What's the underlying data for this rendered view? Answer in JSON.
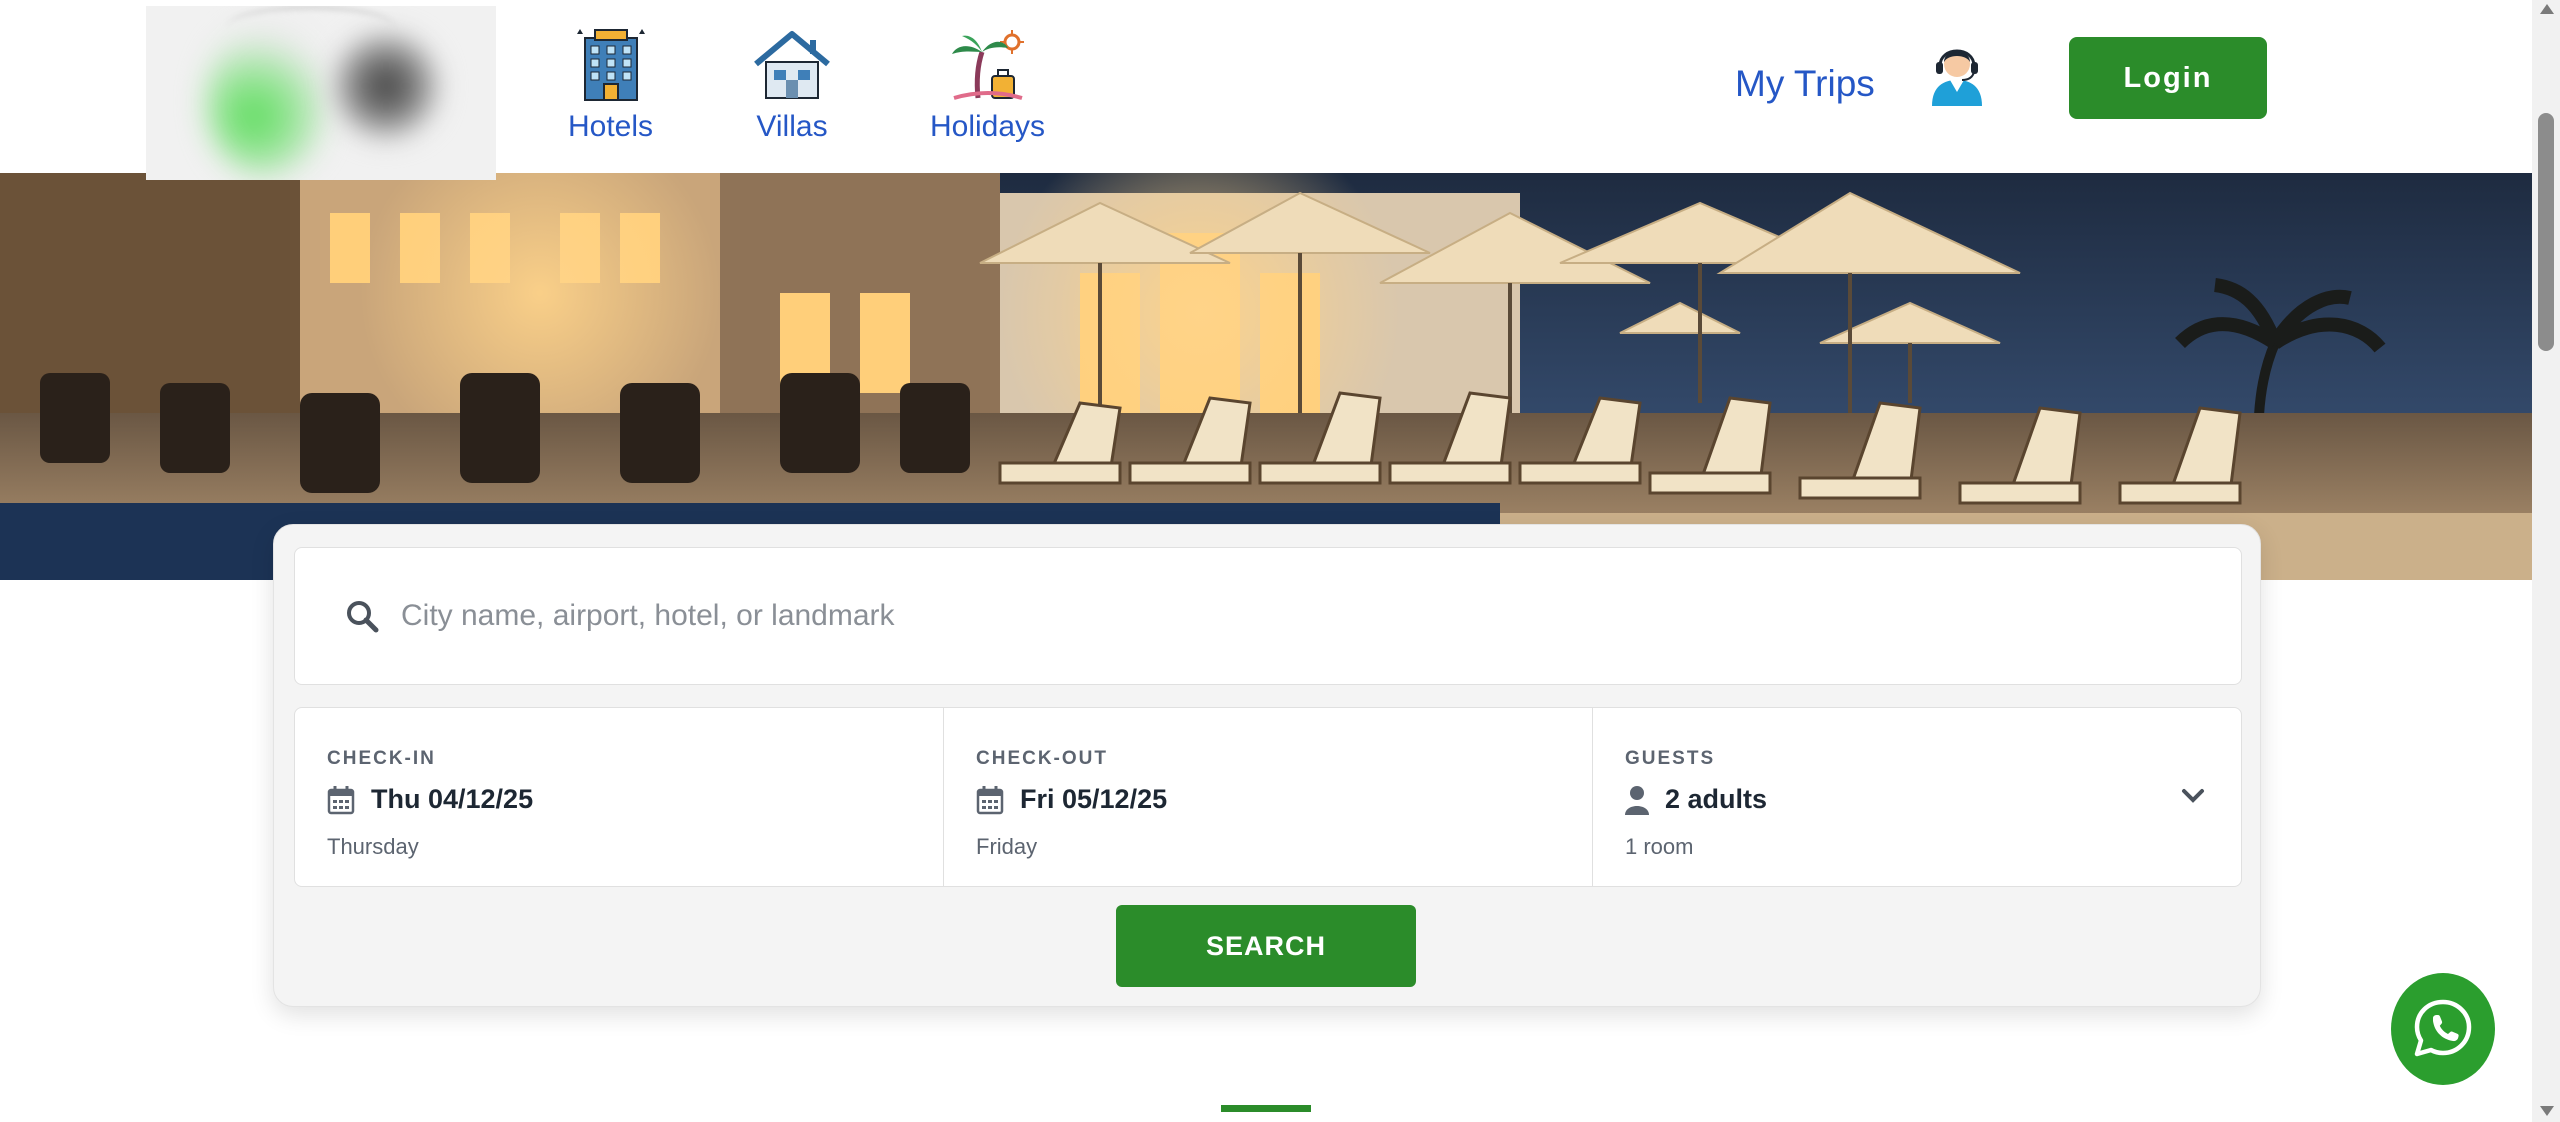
{
  "nav": {
    "items": [
      {
        "label": "Hotels",
        "icon": "hotel-building-icon"
      },
      {
        "label": "Villas",
        "icon": "villa-house-icon"
      },
      {
        "label": "Holidays",
        "icon": "palm-beach-icon"
      }
    ],
    "my_trips": "My Trips",
    "support_icon": "customer-support-icon",
    "login": "Login"
  },
  "search": {
    "placeholder": "City name, airport, hotel, or landmark",
    "icon": "search-icon"
  },
  "fields": {
    "checkin": {
      "label": "CHECK-IN",
      "value": "Thu 04/12/25",
      "sub": "Thursday"
    },
    "checkout": {
      "label": "CHECK-OUT",
      "value": "Fri 05/12/25",
      "sub": "Friday"
    },
    "guests": {
      "label": "GUESTS",
      "value": "2 adults",
      "sub": "1 room"
    }
  },
  "search_button": "SEARCH",
  "colors": {
    "brand_green": "#2b8c2a",
    "link_blue": "#2557c6",
    "whatsapp_green": "#2b9e2e"
  }
}
